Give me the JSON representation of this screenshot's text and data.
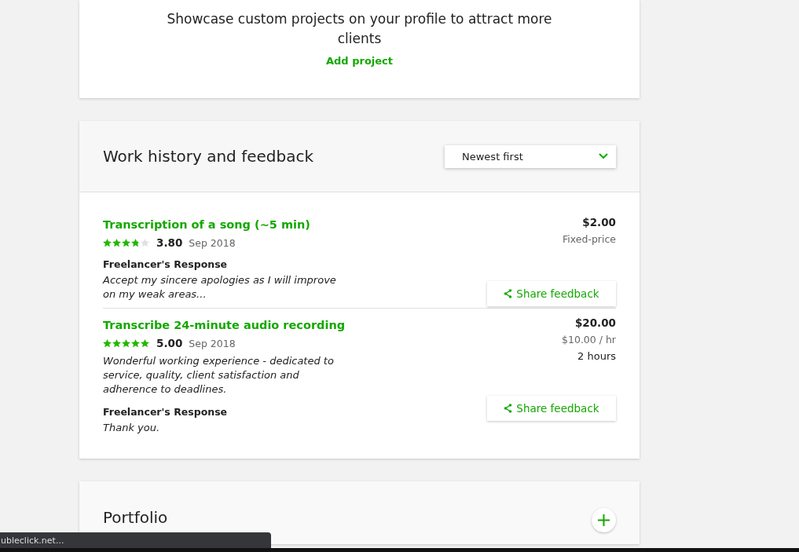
{
  "promo": {
    "message": "Showcase custom projects on your profile to attract more clients",
    "link": "Add project"
  },
  "work_history": {
    "title": "Work history and feedback",
    "sort": {
      "value": "Newest first"
    },
    "jobs": [
      {
        "title": "Transcription of a song (~5 min)",
        "stars": 3.8,
        "rating": "3.80",
        "date": "Sep 2018",
        "amount": "$2.00",
        "rate": "Fixed-price",
        "response_label": "Freelancer's Response",
        "response": "Accept my sincere apologies as I will improve on my weak areas...",
        "share": "Share feedback"
      },
      {
        "title": "Transcribe 24-minute audio recording",
        "stars": 5,
        "rating": "5.00",
        "date": "Sep 2018",
        "amount": "$20.00",
        "rate": "$10.00 / hr",
        "duration": "2 hours",
        "feedback": "Wonderful working experience - dedicated to service, quality, client satisfaction and adherence to deadlines.",
        "response_label": "Freelancer's Response",
        "response": "Thank you.",
        "share": "Share feedback"
      }
    ]
  },
  "portfolio": {
    "title": "Portfolio"
  },
  "status_bar": {
    "url": "ubleclick.net..."
  }
}
